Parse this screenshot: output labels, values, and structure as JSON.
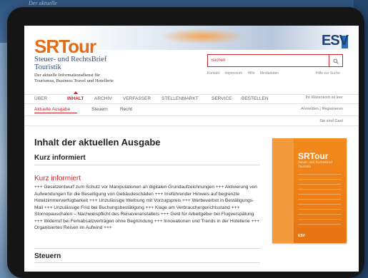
{
  "background": {
    "top_text": "Der aktuelle"
  },
  "header": {
    "logo": "SRTour",
    "logo_sub_line1": "Steuer- und RechtsBrief",
    "logo_sub_line2": "Touristik",
    "logo_desc_line1": "Der aktuelle Informationsdienst für",
    "logo_desc_line2": "Tourismus, Business Travel und Hotellerie",
    "publisher_logo": "ESV",
    "search_placeholder": "Suchen",
    "util_links": [
      "Kontakt",
      "Impressum",
      "Hilfe",
      "Mediadaten"
    ],
    "search_help": "Hilfe zur Suche"
  },
  "nav": {
    "items": [
      "ÜBER",
      "INHALT",
      "ARCHIV",
      "VERFASSER",
      "STELLENMARKT",
      "SERVICE",
      "BESTELLEN"
    ],
    "active": "INHALT",
    "login": "Ihr Warenkorb ist leer"
  },
  "subnav": {
    "items": [
      "Aktuelle Ausgabe",
      "Steuern",
      "Recht"
    ],
    "right": "Anmelden | Registrieren"
  },
  "guest": "Sie sind Gast",
  "main": {
    "title": "Inhalt der aktuellen Ausgabe",
    "section": "Kurz informiert",
    "kurz_heading": "Kurz informiert",
    "body": "+++ Gesetzentwurf zum Schutz vor Manipulationen an digitalen Grundaufzeichnungen +++ Aktivierung von Aufwendungen für die Beseitigung von Gebäudeschäden +++ Irreführender Hinweis auf begrenzte Hotelzimmerverfügbarkeit +++ Unzulässige Werbung mit Vorzugspreis +++ Werbeverbot in Bestätigungs-Mail +++ Unzulässige Frist bei Buchungsbestätigung +++ Klage am Verbrauchergerichtsstand +++ Stornopauschalen – Nachweispflicht des Reiseveranstalters +++ Geld für Arbeitgeber bei Flugverspätung +++ Widerruf bei Fernabsatzverträgen ohne Begründung +++ Innovationen und Trends in der Hotellerie +++ Organisiertes Reisen im Aufwind +++",
    "next_section": "Steuern"
  },
  "cover": {
    "title": "SRTour",
    "sub_line1": "Steuer- und RechtsBrief",
    "sub_line2": "Touristik",
    "foot": "ESV"
  },
  "colors": {
    "brand_orange": "#e36d17",
    "accent_red": "#c9242b",
    "brand_blue": "#2d4f8e"
  }
}
